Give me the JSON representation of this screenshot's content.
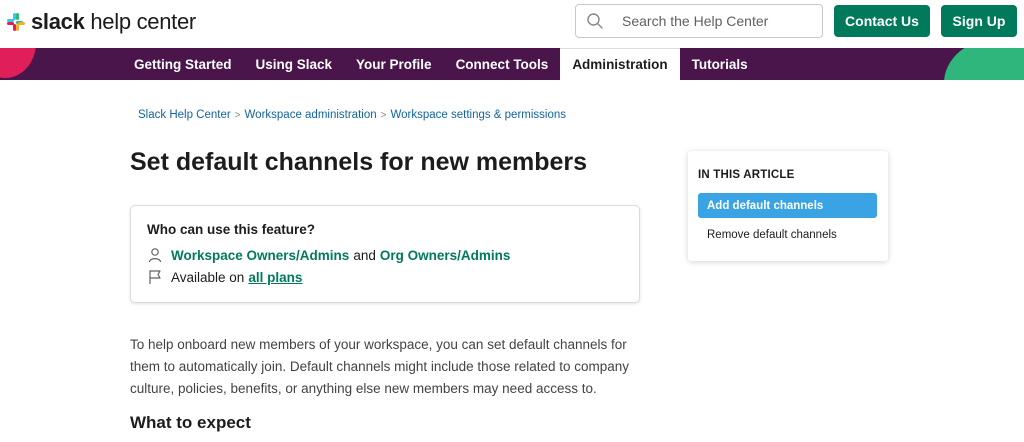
{
  "header": {
    "logo_bold": "slack",
    "logo_light": " help center",
    "search_placeholder": "Search the Help Center",
    "contact_label": "Contact Us",
    "signup_label": "Sign Up"
  },
  "nav": {
    "items": [
      {
        "label": "Getting Started"
      },
      {
        "label": "Using Slack"
      },
      {
        "label": "Your Profile"
      },
      {
        "label": "Connect Tools"
      },
      {
        "label": "Administration"
      },
      {
        "label": "Tutorials"
      }
    ],
    "active_index": 4
  },
  "breadcrumb": {
    "items": [
      "Slack Help Center",
      "Workspace administration",
      "Workspace settings & permissions"
    ],
    "separator": ">"
  },
  "page": {
    "title": "Set default channels for new members"
  },
  "feature_box": {
    "title": "Who can use this feature?",
    "owners_link": "Workspace Owners/Admins",
    "and_text": "and",
    "org_link": "Org Owners/Admins",
    "available_text": "Available on",
    "plans_link": "all plans"
  },
  "content": {
    "intro": "To help onboard new members of your workspace, you can set default channels for them to automatically join. Default channels might include those related to company culture, policies, benefits, or anything else new members may need access to.",
    "section_heading": "What to expect"
  },
  "toc": {
    "title": "IN THIS ARTICLE",
    "items": [
      "Add default channels",
      "Remove default channels"
    ]
  },
  "colors": {
    "aubergine": "#4a154b",
    "green": "#007a5a",
    "link_blue": "#1264a3",
    "toc_active": "#3aa3e3"
  }
}
